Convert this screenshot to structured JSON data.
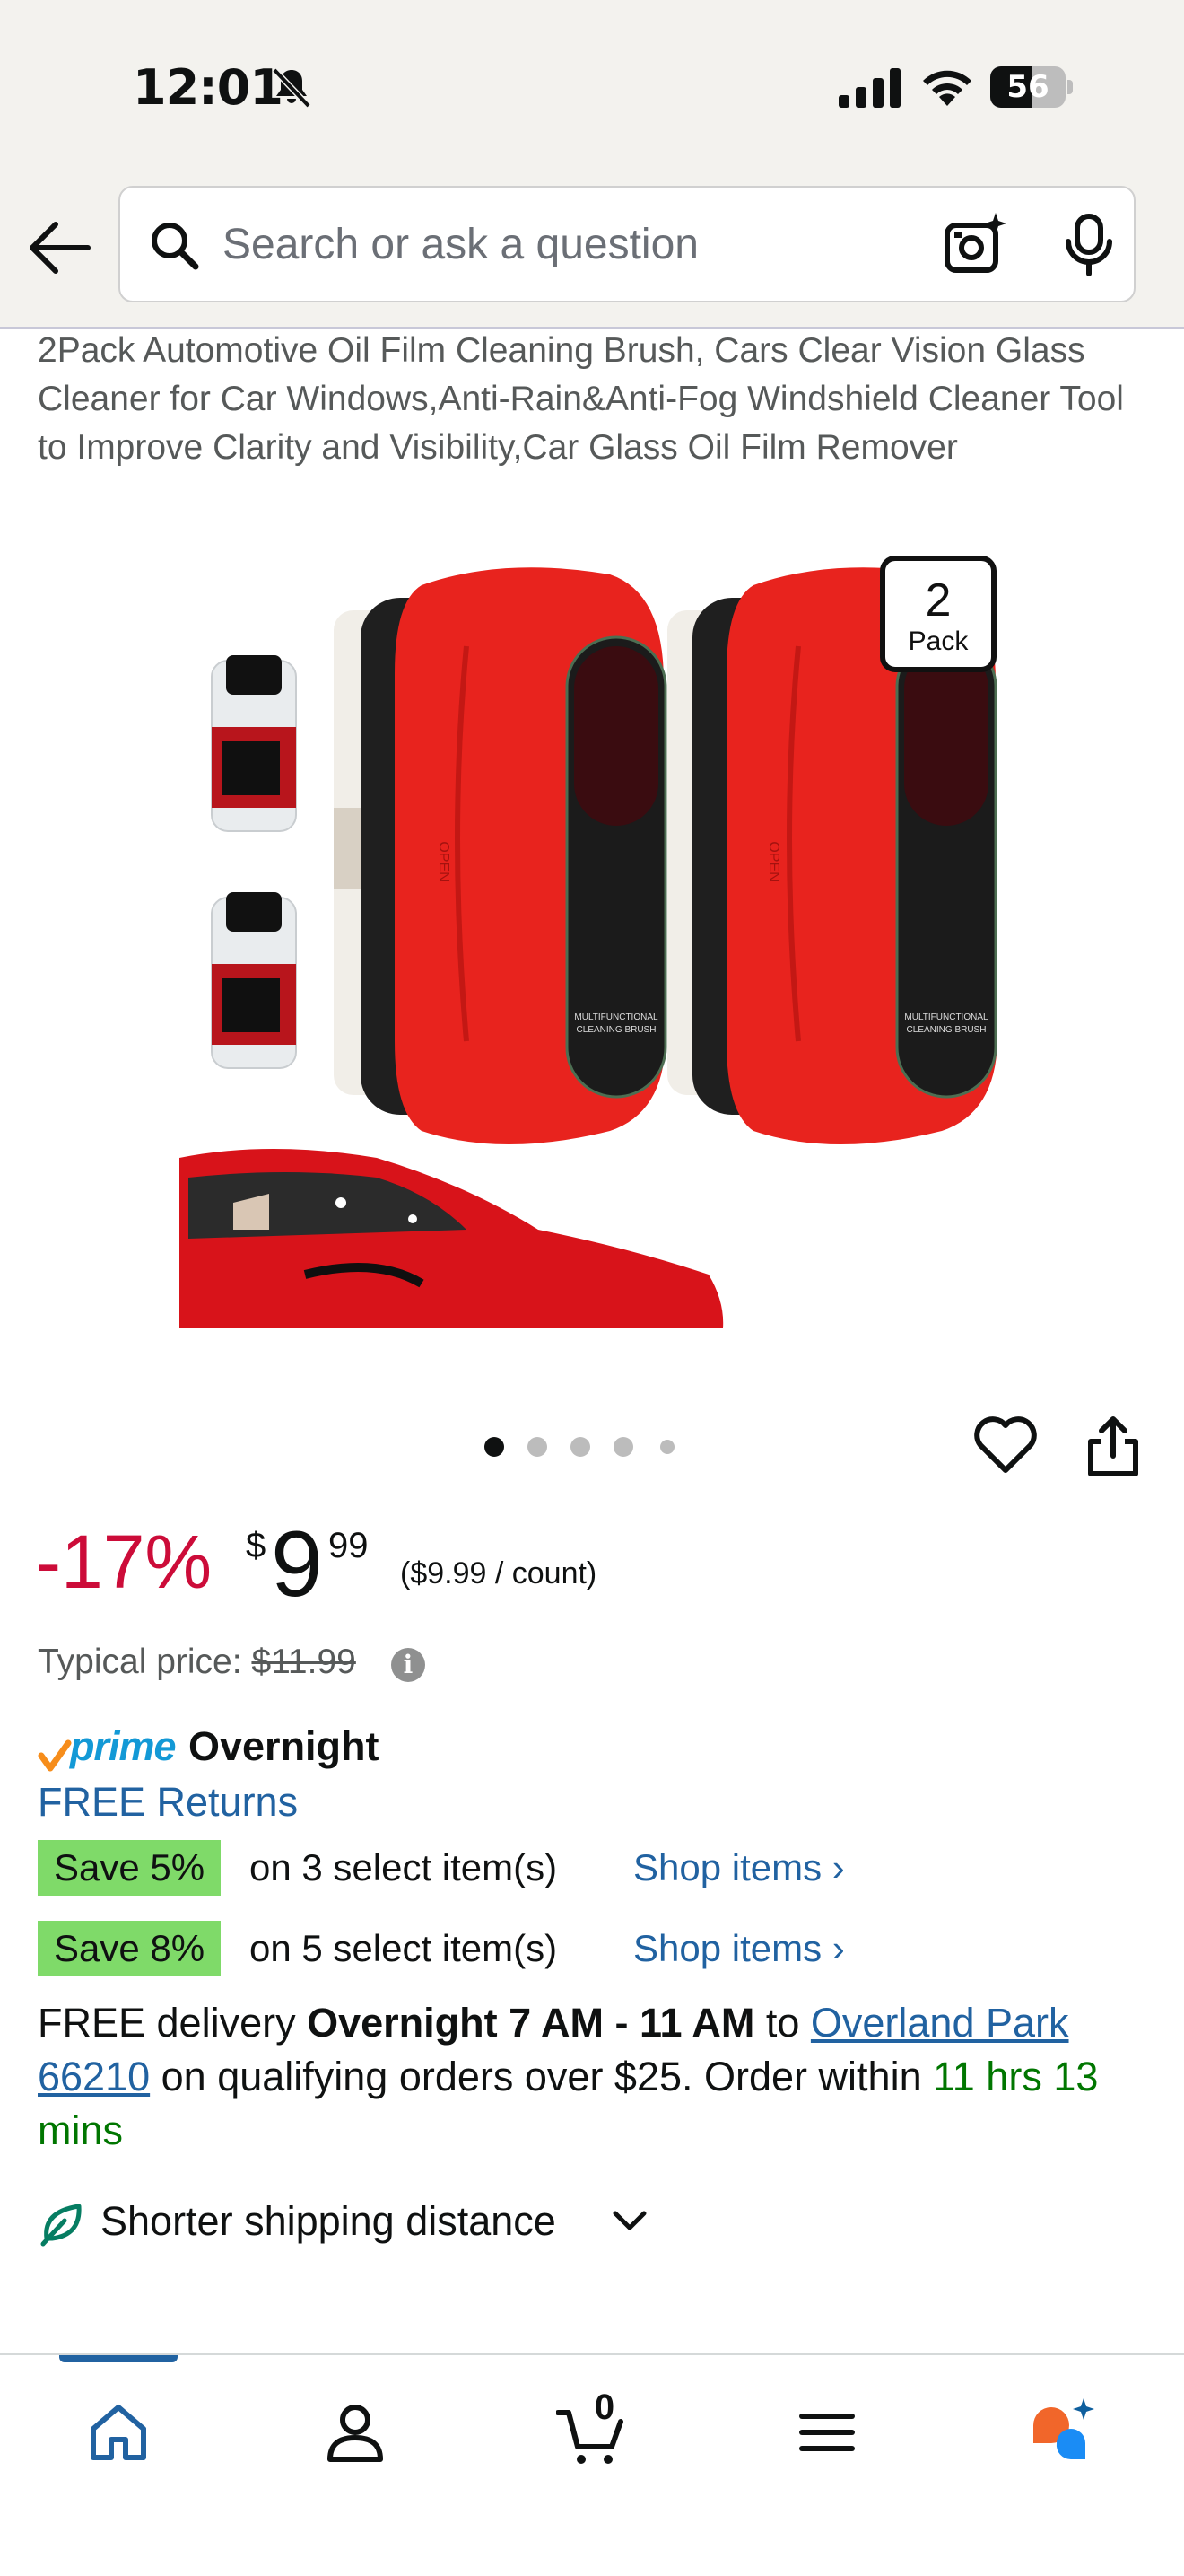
{
  "status_bar": {
    "time": "12:01",
    "battery_level": "56",
    "battery_fill": 0.56
  },
  "search": {
    "placeholder": "Search or ask a question",
    "value": ""
  },
  "product": {
    "title": "2Pack Automotive Oil Film Cleaning Brush, Cars Clear Vision Glass Cleaner for Car Windows,Anti-Rain&Anti-Fog Windshield Cleaner Tool to Improve Clarity and Visibility,Car Glass Oil Film Remover",
    "image": {
      "pack_number": "2",
      "pack_label": "Pack",
      "device_text_line1": "MULTIFUNCTIONAL",
      "device_text_line2": "CLEANING BRUSH",
      "device_side_text": "OPEN",
      "colors": {
        "device_red": "#e8231e",
        "device_black": "#1d1d1d",
        "car_red": "#d8131a"
      }
    },
    "carousel": {
      "count": 5,
      "active_index": 0
    }
  },
  "price": {
    "discount": "-17%",
    "currency": "$",
    "whole": "9",
    "fraction": "99",
    "unit_price": "($9.99 / count)",
    "typical_label": "Typical price:",
    "typical_value": "$11.99",
    "info_glyph": "i"
  },
  "delivery_badges": {
    "prime": "prime",
    "speed": "Overnight",
    "free_returns": "FREE Returns"
  },
  "promos": [
    {
      "badge": "Save 5%",
      "text": "on 3 select item(s)",
      "link": "Shop items ›"
    },
    {
      "badge": "Save 8%",
      "text": "on 5 select item(s)",
      "link": "Shop items ›"
    }
  ],
  "delivery": {
    "prefix": "FREE delivery ",
    "window": "Overnight 7 AM - 11 AM",
    "to": " to ",
    "location": "Overland Park 66210",
    "suffix": " on qualifying orders over $25. Order within ",
    "countdown": "11 hrs 13 mins"
  },
  "shipping": {
    "label": "Shorter shipping distance"
  },
  "bottom_nav": {
    "items": [
      "home-icon",
      "account-icon",
      "cart-icon",
      "menu-icon",
      "rufus-icon"
    ],
    "cart_count": "0"
  },
  "colors": {
    "accent_link": "#2162a1",
    "discount_red": "#cc0c39",
    "save_green": "#7fda69",
    "countdown_green": "#007600",
    "prime_blue": "#1399d6",
    "prime_check": "#f68d1b"
  }
}
